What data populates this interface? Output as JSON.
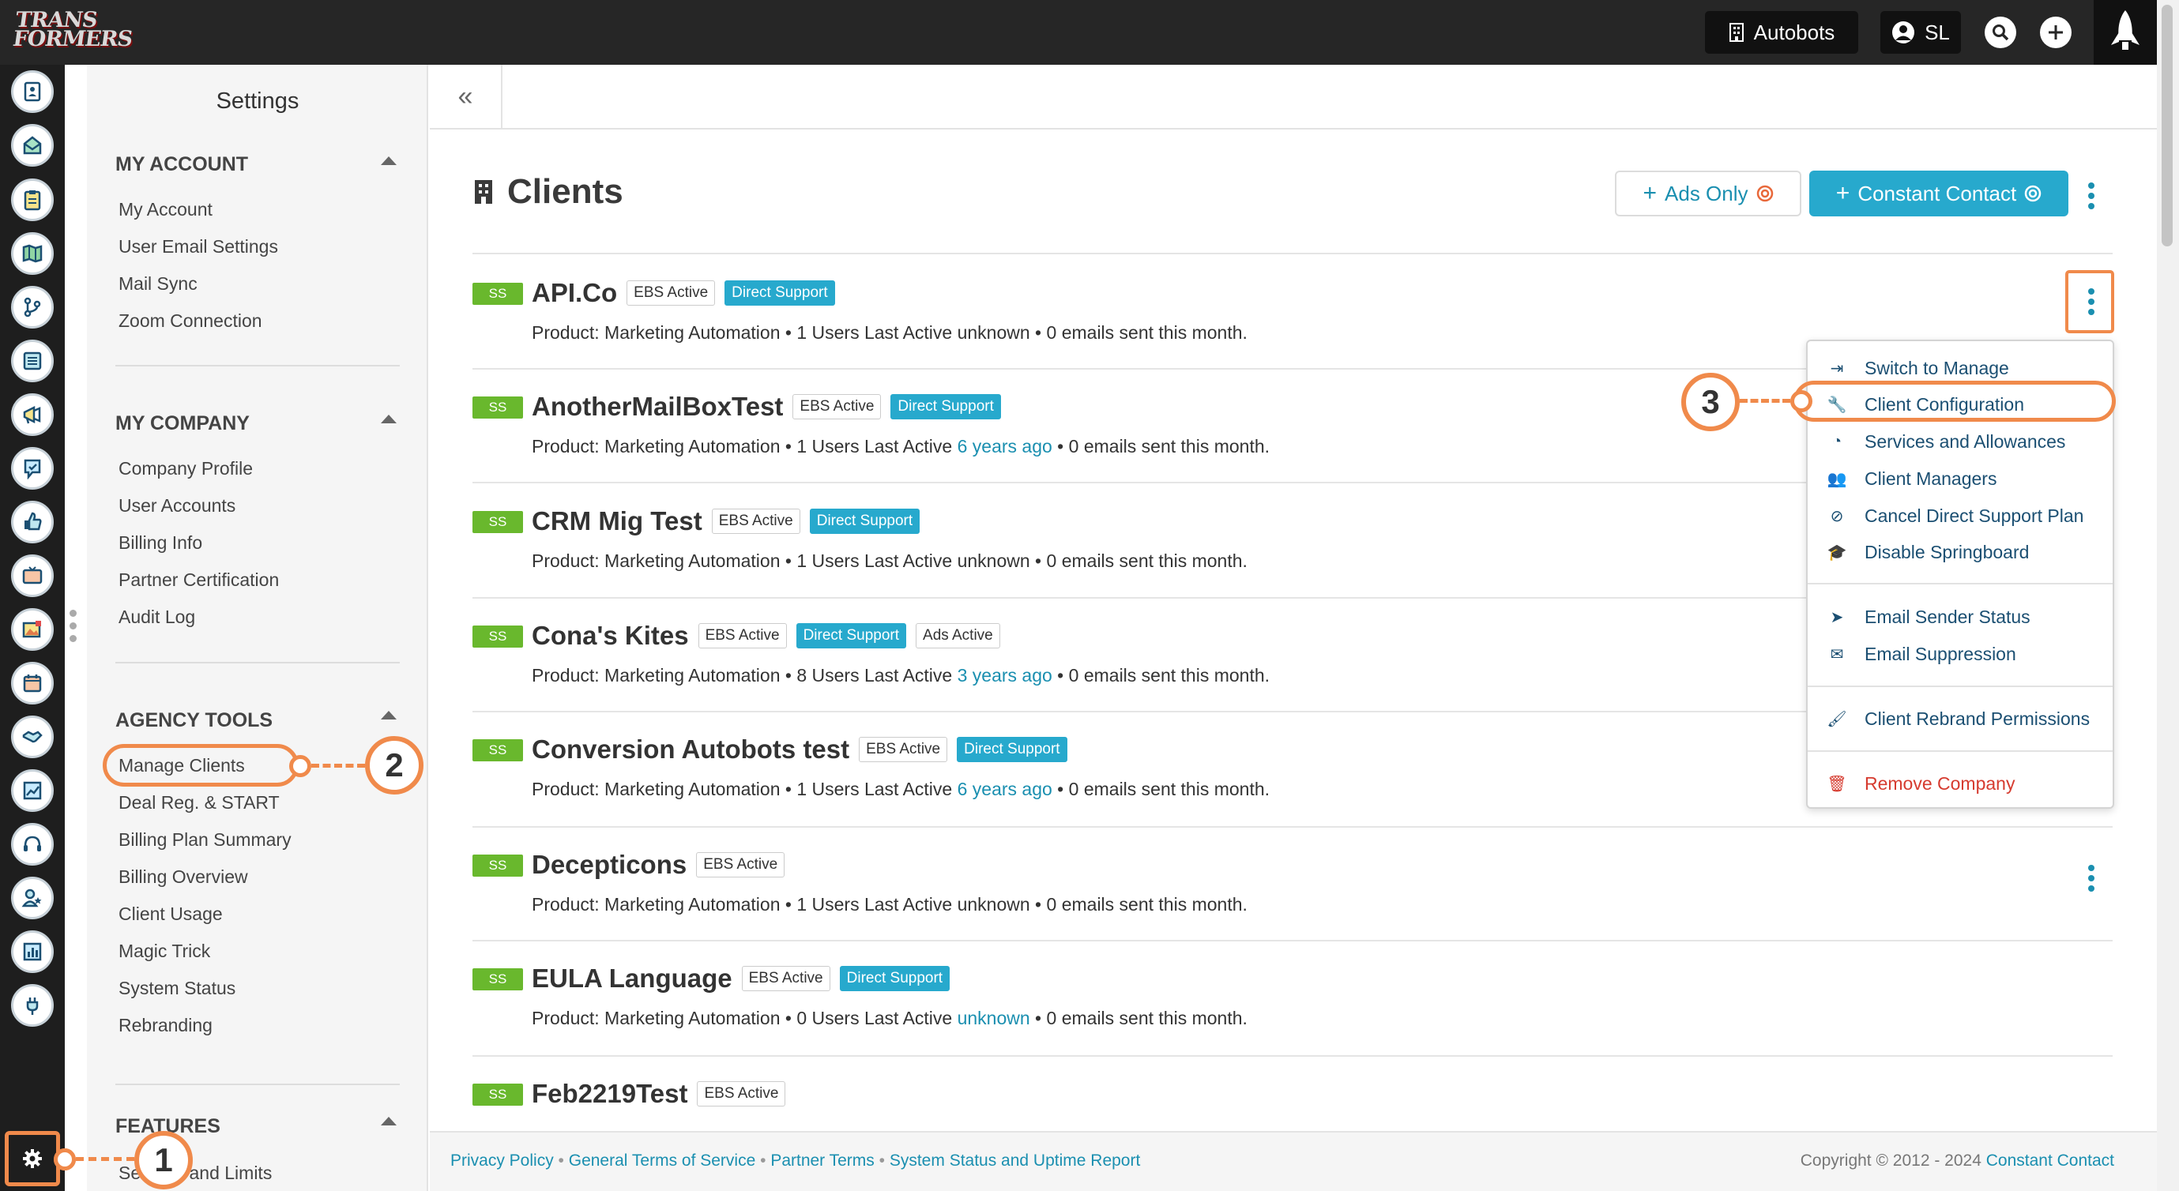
{
  "brand": {
    "logo_line1": "TRANS",
    "logo_line2": "FORMERS"
  },
  "topbar": {
    "account_label": "Autobots",
    "user_initials": "SL",
    "search_icon": "search-icon",
    "add_icon": "plus-icon"
  },
  "sidebar": {
    "title": "Settings",
    "sections": [
      {
        "heading": "MY ACCOUNT",
        "items": [
          "My Account",
          "User Email Settings",
          "Mail Sync",
          "Zoom Connection"
        ]
      },
      {
        "heading": "MY COMPANY",
        "items": [
          "Company Profile",
          "User Accounts",
          "Billing Info",
          "Partner Certification",
          "Audit Log"
        ]
      },
      {
        "heading": "AGENCY TOOLS",
        "items": [
          "Manage Clients",
          "Deal Reg. & START",
          "Billing Plan Summary",
          "Billing Overview",
          "Client Usage",
          "Magic Trick",
          "System Status",
          "Rebranding"
        ]
      },
      {
        "heading": "FEATURES",
        "items": [
          "Settings and Limits"
        ]
      }
    ]
  },
  "page": {
    "title": "Clients",
    "ads_only_label": "Ads Only",
    "constant_contact_label": "Constant Contact"
  },
  "clients": [
    {
      "badge": "SS",
      "name": "API.Co",
      "tags": [
        "EBS Active",
        "Direct Support"
      ],
      "product": "Product: Marketing Automation",
      "users": "1 Users Last Active",
      "last_active": "unknown",
      "emails": "0 emails sent this month."
    },
    {
      "badge": "SS",
      "name": "AnotherMailBoxTest",
      "tags": [
        "EBS Active",
        "Direct Support"
      ],
      "product": "Product: Marketing Automation",
      "users": "1 Users Last Active",
      "last_active": "6 years ago",
      "emails": "0 emails sent this month."
    },
    {
      "badge": "SS",
      "name": "CRM Mig Test",
      "tags": [
        "EBS Active",
        "Direct Support"
      ],
      "product": "Product: Marketing Automation",
      "users": "1 Users Last Active",
      "last_active": "unknown",
      "emails": "0 emails sent this month."
    },
    {
      "badge": "SS",
      "name": "Cona's Kites",
      "tags": [
        "EBS Active",
        "Direct Support",
        "Ads Active"
      ],
      "product": "Product: Marketing Automation",
      "users": "8 Users Last Active",
      "last_active": "3 years ago",
      "emails": "0 emails sent this month."
    },
    {
      "badge": "SS",
      "name": "Conversion Autobots test",
      "tags": [
        "EBS Active",
        "Direct Support"
      ],
      "product": "Product: Marketing Automation",
      "users": "1 Users Last Active",
      "last_active": "6 years ago",
      "emails": "0 emails sent this month."
    },
    {
      "badge": "SS",
      "name": "Decepticons",
      "tags": [
        "EBS Active"
      ],
      "product": "Product: Marketing Automation",
      "users": "1 Users Last Active",
      "last_active": "unknown",
      "emails": "0 emails sent this month."
    },
    {
      "badge": "SS",
      "name": "EULA Language",
      "tags": [
        "EBS Active",
        "Direct Support"
      ],
      "product": "Product: Marketing Automation",
      "users": "0 Users Last Active",
      "last_active": "unknown",
      "emails": "0 emails sent this month."
    },
    {
      "badge": "SS",
      "name": "Feb2219Test",
      "tags": [
        "EBS Active"
      ],
      "product": "",
      "users": "",
      "last_active": "",
      "emails": ""
    }
  ],
  "menu": [
    {
      "label": "Switch to Manage",
      "icon": "sign-in-icon"
    },
    {
      "label": "Client Configuration",
      "icon": "wrench-icon"
    },
    {
      "label": "Services and Allowances",
      "icon": "gauge-icon"
    },
    {
      "label": "Client Managers",
      "icon": "users-icon"
    },
    {
      "label": "Cancel Direct Support Plan",
      "icon": "ban-icon"
    },
    {
      "label": "Disable Springboard",
      "icon": "graduation-cap-icon"
    },
    {
      "label": "Email Sender Status",
      "icon": "paper-plane-icon"
    },
    {
      "label": "Email Suppression",
      "icon": "envelope-icon"
    },
    {
      "label": "Client Rebrand Permissions",
      "icon": "brush-icon"
    },
    {
      "label": "Remove Company",
      "icon": "trash-icon"
    }
  ],
  "callouts": [
    "1",
    "2",
    "3"
  ],
  "footer": {
    "links": [
      "Privacy Policy",
      "General Terms of Service",
      "Partner Terms",
      "System Status and Uptime Report"
    ],
    "copyright": "Copyright © 2012 - 2024",
    "company": "Constant Contact"
  },
  "colors": {
    "accent": "#27a9cd",
    "highlight": "#f08a4b",
    "badge_green": "#69b82d",
    "danger": "#d63b2f"
  }
}
